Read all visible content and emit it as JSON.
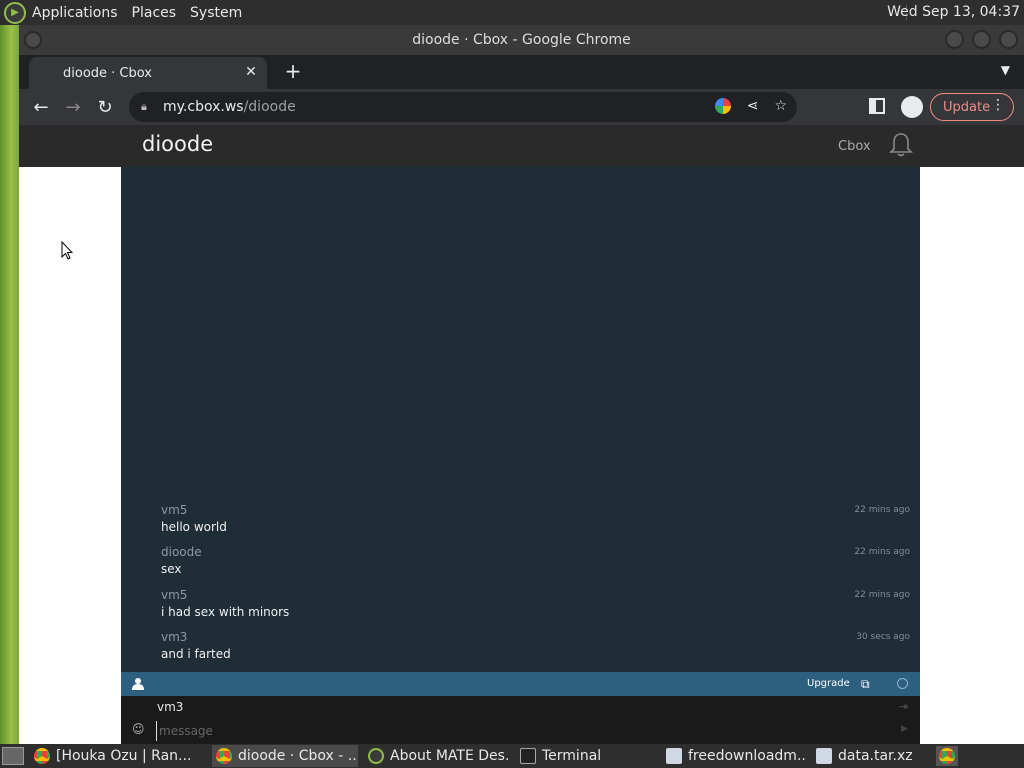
{
  "top_panel": {
    "menus": [
      "Applications",
      "Places",
      "System"
    ],
    "clock": "Wed Sep 13, 04:37"
  },
  "window": {
    "title": "dioode · Cbox - Google Chrome"
  },
  "browser": {
    "tab_title": "dioode · Cbox",
    "url_host": "my.cbox.ws",
    "url_path": "/dioode",
    "update_label": "Update"
  },
  "site": {
    "title": "dioode",
    "cbox_link": "Cbox"
  },
  "chat": {
    "messages": [
      {
        "author": "vm5",
        "text": "hello world",
        "time": "22 mins ago"
      },
      {
        "author": "dioode",
        "text": "sex",
        "time": "22 mins ago"
      },
      {
        "author": "vm5",
        "text": "i had sex with minors",
        "time": "22 mins ago"
      },
      {
        "author": "vm3",
        "text": "and i farted",
        "time": "30 secs ago"
      }
    ],
    "upgrade_label": "Upgrade",
    "current_user": "vm3",
    "message_placeholder": "message"
  },
  "taskbar": {
    "tasks": [
      {
        "label": "[Houka Ozu | Ran...",
        "icon": "chrome-icon"
      },
      {
        "label": "dioode · Cbox - ...",
        "icon": "chrome-icon"
      },
      {
        "label": "About MATE Des...",
        "icon": "mate-icon"
      },
      {
        "label": "Terminal",
        "icon": "terminal-icon"
      },
      {
        "label": "freedownloadm...",
        "icon": "document-icon"
      },
      {
        "label": "data.tar.xz",
        "icon": "document-icon"
      }
    ]
  },
  "colors": {
    "chat_bg": "#1f2d37",
    "chat_bar": "#2d5f80",
    "update_accent": "#f28b82"
  }
}
